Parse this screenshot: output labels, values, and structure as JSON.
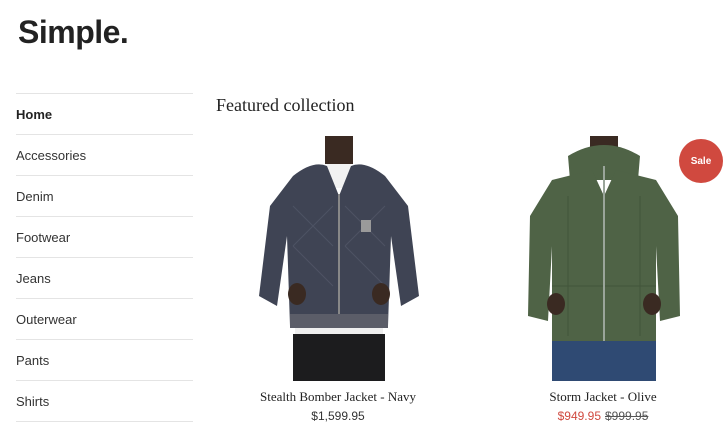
{
  "header": {
    "logo_text": "Simple."
  },
  "sidebar": {
    "items": [
      {
        "label": "Home",
        "active": true
      },
      {
        "label": "Accessories"
      },
      {
        "label": "Denim"
      },
      {
        "label": "Footwear"
      },
      {
        "label": "Jeans"
      },
      {
        "label": "Outerwear"
      },
      {
        "label": "Pants"
      },
      {
        "label": "Shirts"
      }
    ]
  },
  "main": {
    "title": "Featured collection",
    "products": [
      {
        "name": "Stealth Bomber Jacket - Navy",
        "price": "$1,599.95",
        "image_icon": "navy-bomber-jacket-photo",
        "color": "#3f4454"
      },
      {
        "name": "Storm Jacket - Olive",
        "sale_price": "$949.95",
        "compare_price": "$999.95",
        "badge": "Sale",
        "image_icon": "olive-hooded-jacket-photo",
        "color": "#4f6346"
      }
    ]
  },
  "colors": {
    "accent_sale": "#d0493f",
    "divider": "#e4e4e4",
    "text": "#222222"
  }
}
